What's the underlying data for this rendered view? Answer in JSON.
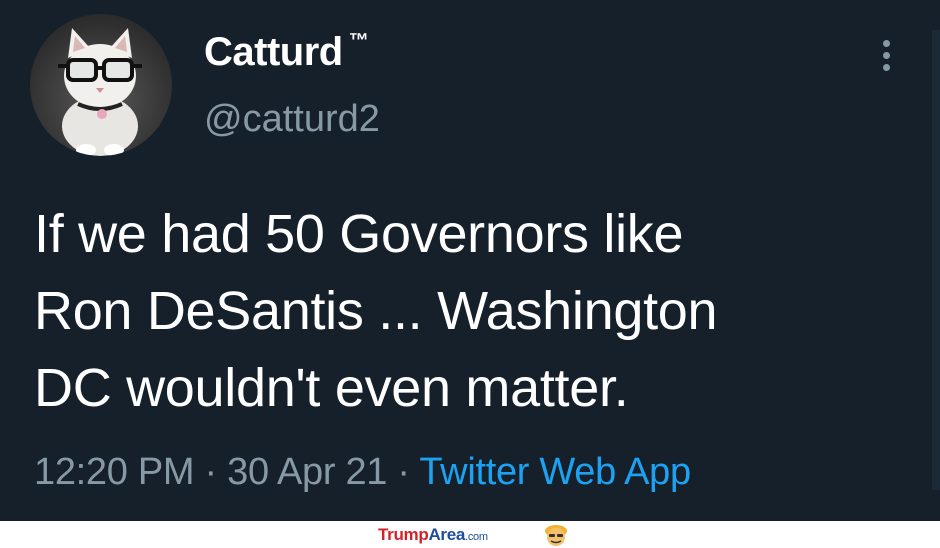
{
  "tweet": {
    "display_name": "Catturd",
    "trademark": "™",
    "handle": "@catturd2",
    "text_lines": [
      "If we had 50 Governors like",
      "Ron DeSantis ... Washington",
      "DC wouldn't even matter."
    ],
    "time": "12:20 PM",
    "separator": "·",
    "date": "30 Apr 21",
    "source": "Twitter Web App"
  },
  "watermark": {
    "part1": "Trump",
    "part2": "Area",
    "part3": ".com"
  },
  "icons": {
    "more": "more-vertical-icon",
    "avatar": "cat-with-glasses-avatar",
    "watermark_face": "trump-face-icon"
  },
  "colors": {
    "background": "#15202b",
    "primary_text": "#ffffff",
    "secondary_text": "#8899a6",
    "link": "#1da1f2"
  }
}
